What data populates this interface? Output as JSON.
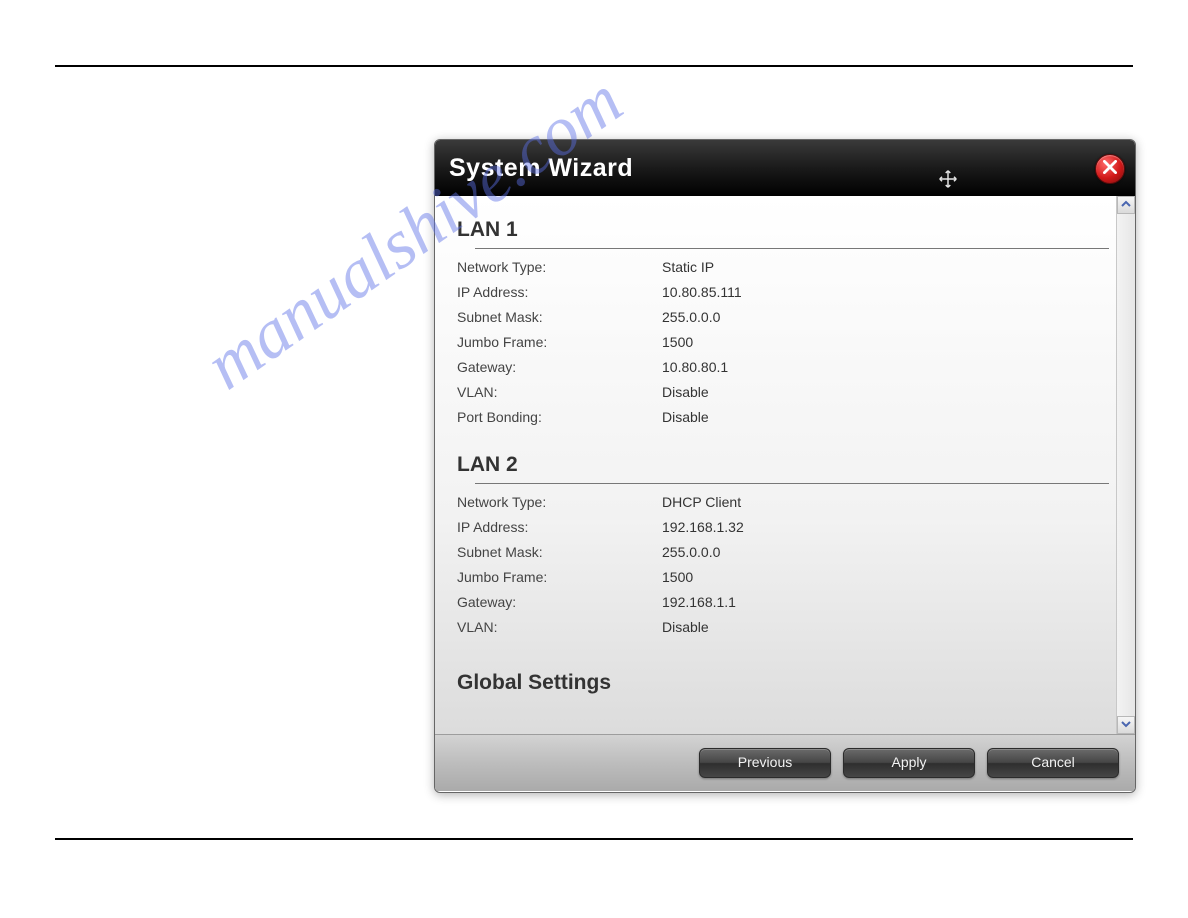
{
  "dialog": {
    "title": "System Wizard"
  },
  "sections": {
    "lan1": {
      "title": "LAN 1",
      "rows": {
        "network_type": {
          "label": "Network Type:",
          "value": "Static IP"
        },
        "ip_address": {
          "label": "IP Address:",
          "value": "10.80.85.111"
        },
        "subnet_mask": {
          "label": "Subnet Mask:",
          "value": "255.0.0.0"
        },
        "jumbo_frame": {
          "label": "Jumbo Frame:",
          "value": "1500"
        },
        "gateway": {
          "label": "Gateway:",
          "value": "10.80.80.1"
        },
        "vlan": {
          "label": "VLAN:",
          "value": "Disable"
        },
        "port_bonding": {
          "label": "Port Bonding:",
          "value": "Disable"
        }
      }
    },
    "lan2": {
      "title": "LAN 2",
      "rows": {
        "network_type": {
          "label": "Network Type:",
          "value": "DHCP Client"
        },
        "ip_address": {
          "label": "IP Address:",
          "value": "192.168.1.32"
        },
        "subnet_mask": {
          "label": "Subnet Mask:",
          "value": "255.0.0.0"
        },
        "jumbo_frame": {
          "label": "Jumbo Frame:",
          "value": "1500"
        },
        "gateway": {
          "label": "Gateway:",
          "value": "192.168.1.1"
        },
        "vlan": {
          "label": "VLAN:",
          "value": "Disable"
        }
      }
    },
    "global": {
      "title": "Global Settings"
    }
  },
  "footer": {
    "previous": "Previous",
    "apply": "Apply",
    "cancel": "Cancel"
  },
  "watermark": "manualshive.com"
}
